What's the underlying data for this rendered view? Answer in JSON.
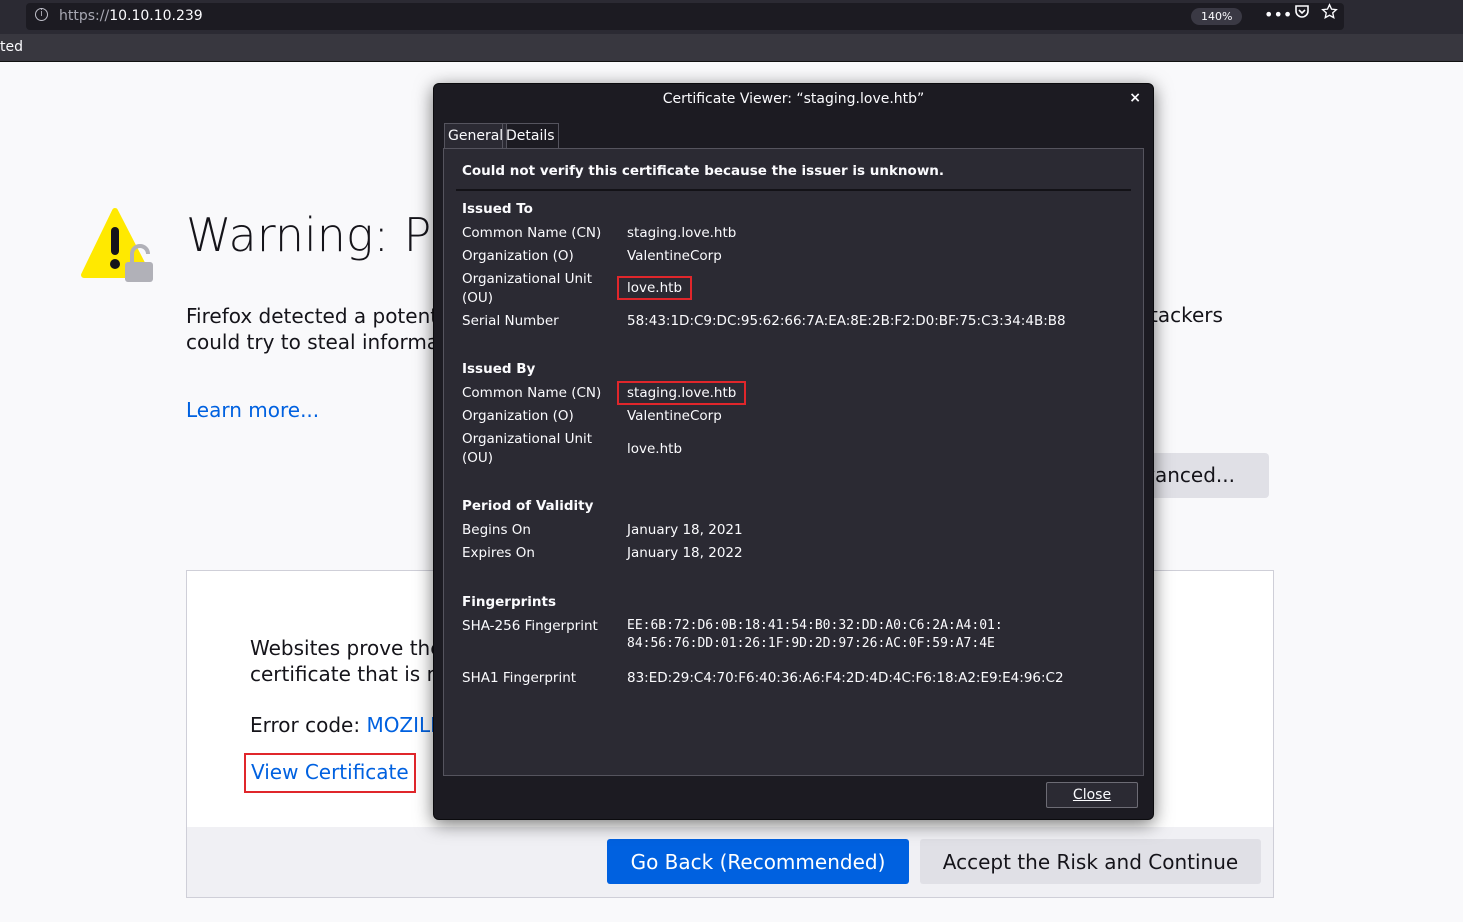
{
  "browser": {
    "url_protocol": "https://",
    "url_host": "10.10.10.239",
    "zoom": "140%",
    "strip_text": "ted",
    "icons": [
      "info-icon",
      "more-icon",
      "pocket-icon",
      "bookmark-star-icon"
    ]
  },
  "page": {
    "title": "Warning: Pot",
    "intro_line1": "Firefox detected a potentia",
    "intro_line2": "could try to steal informat",
    "intro_right": "tackers",
    "learn_more": "Learn more...",
    "advanced_label": "lvanced...",
    "panel_line1": "Websites prove the",
    "panel_line2": "certificate that is no",
    "error_label": "Error code: ",
    "error_code": "MOZILL",
    "view_certificate": "View Certificate",
    "go_back": "Go Back (Recommended)",
    "accept": "Accept the Risk and Continue"
  },
  "dialog": {
    "title": "Certificate Viewer: “staging.love.htb”",
    "close_x": "×",
    "tabs": [
      "General",
      "Details"
    ],
    "warning": "Could not verify this certificate because the issuer is unknown.",
    "issued_to": {
      "heading": "Issued To",
      "cn_label": "Common Name (CN)",
      "cn": "staging.love.htb",
      "o_label": "Organization (O)",
      "o": "ValentineCorp",
      "ou_label1": "Organizational Unit",
      "ou_label2": "(OU)",
      "ou": "love.htb",
      "serial_label": "Serial Number",
      "serial": "58:43:1D:C9:DC:95:62:66:7A:EA:8E:2B:F2:D0:BF:75:C3:34:4B:B8"
    },
    "issued_by": {
      "heading": "Issued By",
      "cn_label": "Common Name (CN)",
      "cn": "staging.love.htb",
      "o_label": "Organization (O)",
      "o": "ValentineCorp",
      "ou_label1": "Organizational Unit",
      "ou_label2": "(OU)",
      "ou": "love.htb"
    },
    "validity": {
      "heading": "Period of Validity",
      "begins_label": "Begins On",
      "begins": "January 18, 2021",
      "expires_label": "Expires On",
      "expires": "January 18, 2022"
    },
    "fingerprints": {
      "heading": "Fingerprints",
      "sha256_label": "SHA-256 Fingerprint",
      "sha256_line1": "EE:6B:72:D6:0B:18:41:54:B0:32:DD:A0:C6:2A:A4:01:",
      "sha256_line2": "84:56:76:DD:01:26:1F:9D:2D:97:26:AC:0F:59:A7:4E",
      "sha1_label": "SHA1 Fingerprint",
      "sha1": "83:ED:29:C4:70:F6:40:36:A6:F4:2D:4D:4C:F6:18:A2:E9:E4:96:C2"
    },
    "close_label": "Close"
  }
}
